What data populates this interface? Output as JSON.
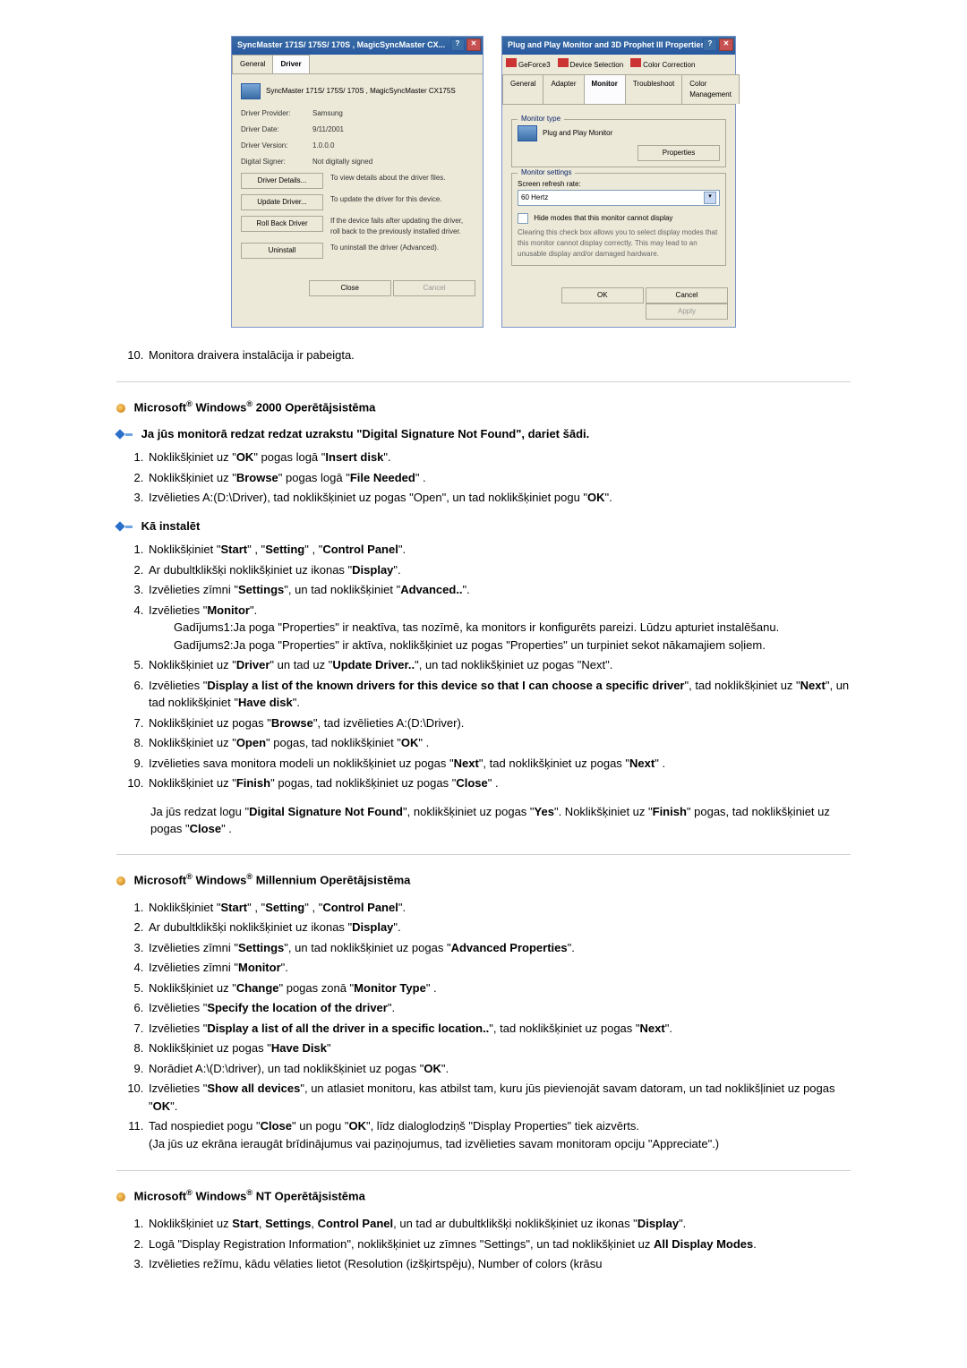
{
  "dialog1": {
    "title": "SyncMaster 171S/ 175S/ 170S , MagicSyncMaster CX...",
    "tabs": {
      "general": "General",
      "driver": "Driver"
    },
    "deviceLine": "SyncMaster 171S/ 175S/ 170S , MagicSyncMaster CX175S",
    "prov_lbl": "Driver Provider:",
    "prov_val": "Samsung",
    "date_lbl": "Driver Date:",
    "date_val": "9/11/2001",
    "ver_lbl": "Driver Version:",
    "ver_val": "1.0.0.0",
    "sign_lbl": "Digital Signer:",
    "sign_val": "Not digitally signed",
    "b_details": "Driver Details...",
    "b_details_desc": "To view details about the driver files.",
    "b_update": "Update Driver...",
    "b_update_desc": "To update the driver for this device.",
    "b_roll": "Roll Back Driver",
    "b_roll_desc": "If the device fails after updating the driver, roll back to the previously installed driver.",
    "b_uninstall": "Uninstall",
    "b_uninstall_desc": "To uninstall the driver (Advanced).",
    "close": "Close",
    "cancel": "Cancel"
  },
  "dialog2": {
    "title": "Plug and Play Monitor and 3D Prophet III Properties",
    "top1": "GeForce3",
    "top2": "Device Selection",
    "top3": "Color Correction",
    "tabs": {
      "general": "General",
      "adapter": "Adapter",
      "monitor": "Monitor",
      "trouble": "Troubleshoot",
      "cm": "Color Management"
    },
    "mt_group": "Monitor type",
    "mt_val": "Plug and Play Monitor",
    "properties": "Properties",
    "ms_group": "Monitor settings",
    "rr_lbl": "Screen refresh rate:",
    "rr_val": "60 Hertz",
    "hide_lbl": "Hide modes that this monitor cannot display",
    "hide_desc": "Clearing this check box allows you to select display modes that this monitor cannot display correctly. This may lead to an unusable display and/or damaged hardware.",
    "ok": "OK",
    "cancel": "Cancel",
    "apply": "Apply"
  },
  "step10": {
    "text": "Monitora draivera instalācija ir pabeigta."
  },
  "s2000": {
    "title_a": "Microsoft",
    "title_b": " Windows",
    "title_c": " 2000 Operētājsistēma",
    "note": "Ja jūs monitorā redzat redzat uzrakstu \"Digital Signature Not Found\", dariet šādi.",
    "l1_a": "Noklikšķiniet uz \"",
    "l1_b": "OK",
    "l1_c": "\" pogas logā \"",
    "l1_d": "Insert disk",
    "l1_e": "\".",
    "l2_a": "Noklikšķiniet uz \"",
    "l2_b": "Browse",
    "l2_c": "\" pogas logā \"",
    "l2_d": "File Needed",
    "l2_e": "\" .",
    "l3_a": "Izvēlieties A:(D:\\Driver), tad noklikšķiniet uz pogas \"Open\", un tad noklikšķiniet pogu \"",
    "l3_b": "OK",
    "l3_c": "\".",
    "install": "Kā instalēt",
    "i1_a": "Noklikšķiniet \"",
    "i1_b": "Start",
    "i1_c": "\" , \"",
    "i1_d": "Setting",
    "i1_e": "\" , \"",
    "i1_f": "Control Panel",
    "i1_g": "\".",
    "i2_a": "Ar dubultklikšķi noklikšķiniet uz ikonas \"",
    "i2_b": "Display",
    "i2_c": "\".",
    "i3_a": "Izvēlieties zīmni \"",
    "i3_b": "Settings",
    "i3_c": "\", un tad noklikšķiniet \"",
    "i3_d": "Advanced..",
    "i3_e": "\".",
    "i4_a": "Izvēlieties \"",
    "i4_b": "Monitor",
    "i4_c": "\".",
    "i4c1": "Gadījums1:Ja poga \"Properties\" ir neaktīva, tas nozīmē, ka monitors ir konfigurēts pareizi. Lūdzu apturiet instalēšanu.",
    "i4c2": "Gadījums2:Ja poga \"Properties\" ir aktīva, noklikšķiniet uz pogas \"Properties\" un turpiniet sekot nākamajiem soļiem.",
    "i5_a": "Noklikšķiniet uz \"",
    "i5_b": "Driver",
    "i5_c": "\" un tad uz \"",
    "i5_d": "Update Driver..",
    "i5_e": "\", un tad noklikšķiniet uz pogas \"Next\".",
    "i6_a": "Izvēlieties \"",
    "i6_b": "Display a list of the known drivers for this device so that I can choose a specific driver",
    "i6_c": "\", tad noklikšķiniet uz \"",
    "i6_d": "Next",
    "i6_e": "\", un tad noklikšķiniet \"",
    "i6_f": "Have disk",
    "i6_g": "\".",
    "i7_a": "Noklikšķiniet uz pogas \"",
    "i7_b": "Browse",
    "i7_c": "\", tad izvēlieties A:(D:\\Driver).",
    "i8_a": "Noklikšķiniet uz \"",
    "i8_b": "Open",
    "i8_c": "\" pogas, tad noklikšķiniet \"",
    "i8_d": "OK",
    "i8_e": "\" .",
    "i9_a": "Izvēlieties sava monitora modeli un noklikšķiniet uz pogas \"",
    "i9_b": "Next",
    "i9_c": "\", tad noklikšķiniet uz pogas \"",
    "i9_d": "Next",
    "i9_e": "\" .",
    "i10_a": "Noklikšķiniet uz \"",
    "i10_b": "Finish",
    "i10_c": "\" pogas, tad noklikšķiniet uz pogas \"",
    "i10_d": "Close",
    "i10_e": "\" .",
    "tail1_a": "Ja jūs redzat logu \"",
    "tail1_b": "Digital Signature Not Found",
    "tail1_c": "\", noklikšķiniet uz pogas \"",
    "tail1_d": "Yes",
    "tail1_e": "\". Noklikšķiniet uz \"",
    "tail1_f": "Finish",
    "tail1_g": "\" pogas, tad noklikšķiniet uz pogas \"",
    "tail1_h": "Close",
    "tail1_i": "\" ."
  },
  "sME": {
    "title_a": "Microsoft",
    "title_b": " Windows",
    "title_c": " Millennium Operētājsistēma",
    "l1_a": "Noklikšķiniet \"",
    "l1_b": "Start",
    "l1_c": "\" , \"",
    "l1_d": "Setting",
    "l1_e": "\" , \"",
    "l1_f": "Control Panel",
    "l1_g": "\".",
    "l2_a": "Ar dubultklikšķi noklikšķiniet uz ikonas \"",
    "l2_b": "Display",
    "l2_c": "\".",
    "l3_a": "Izvēlieties zīmni \"",
    "l3_b": "Settings",
    "l3_c": "\", un tad noklikšķiniet uz pogas \"",
    "l3_d": "Advanced Properties",
    "l3_e": "\".",
    "l4_a": "Izvēlieties zīmni \"",
    "l4_b": "Monitor",
    "l4_c": "\".",
    "l5_a": "Noklikšķiniet uz \"",
    "l5_b": "Change",
    "l5_c": "\" pogas zonā \"",
    "l5_d": "Monitor Type",
    "l5_e": "\" .",
    "l6_a": "Izvēlieties \"",
    "l6_b": "Specify the location of the driver",
    "l6_c": "\".",
    "l7_a": "Izvēlieties \"",
    "l7_b": "Display a list of all the driver in a specific location..",
    "l7_c": "\", tad noklikšķiniet uz pogas \"",
    "l7_d": "Next",
    "l7_e": "\".",
    "l8_a": "Noklikšķiniet uz pogas \"",
    "l8_b": "Have Disk",
    "l8_c": "\"",
    "l9_a": "Norādiet A:\\(D:\\driver), un tad noklikšķiniet uz pogas \"",
    "l9_b": "OK",
    "l9_c": "\".",
    "l10_a": "Izvēlieties \"",
    "l10_b": "Show all devices",
    "l10_c": "\", un atlasiet monitoru, kas atbilst tam, kuru jūs pievienojāt savam datoram, un tad noklikšļiniet uz pogas \"",
    "l10_d": "OK",
    "l10_e": "\".",
    "l11_a": "Tad nospiediet pogu \"",
    "l11_b": "Close",
    "l11_c": "\" un pogu \"",
    "l11_d": "OK",
    "l11_e": "\", līdz dialoglodziņš \"Display Properties\" tiek aizvērts.",
    "l11_f": "(Ja jūs uz ekrāna ieraugāt brīdinājumus vai paziņojumus, tad izvēlieties savam monitoram opciju \"Appreciate\".)"
  },
  "sNT": {
    "title_a": "Microsoft",
    "title_b": " Windows",
    "title_c": " NT Operētājsistēma",
    "l1_a": "Noklikšķiniet uz ",
    "l1_b": "Start",
    "l1_c": ", ",
    "l1_d": "Settings",
    "l1_e": ", ",
    "l1_f": "Control Panel",
    "l1_g": ", un tad ar dubultklikšķi noklikšķiniet uz ikonas \"",
    "l1_h": "Display",
    "l1_i": "\".",
    "l2_a": "Logā \"Display Registration Information\", noklikšķiniet uz zīmnes \"Settings\", un tad noklikšķiniet uz ",
    "l2_b": "All Display Modes",
    "l2_c": ".",
    "l3_a": "Izvēlieties režīmu, kādu vēlaties lietot (Resolution (izšķirtspēju), Number of colors (krāsu"
  }
}
